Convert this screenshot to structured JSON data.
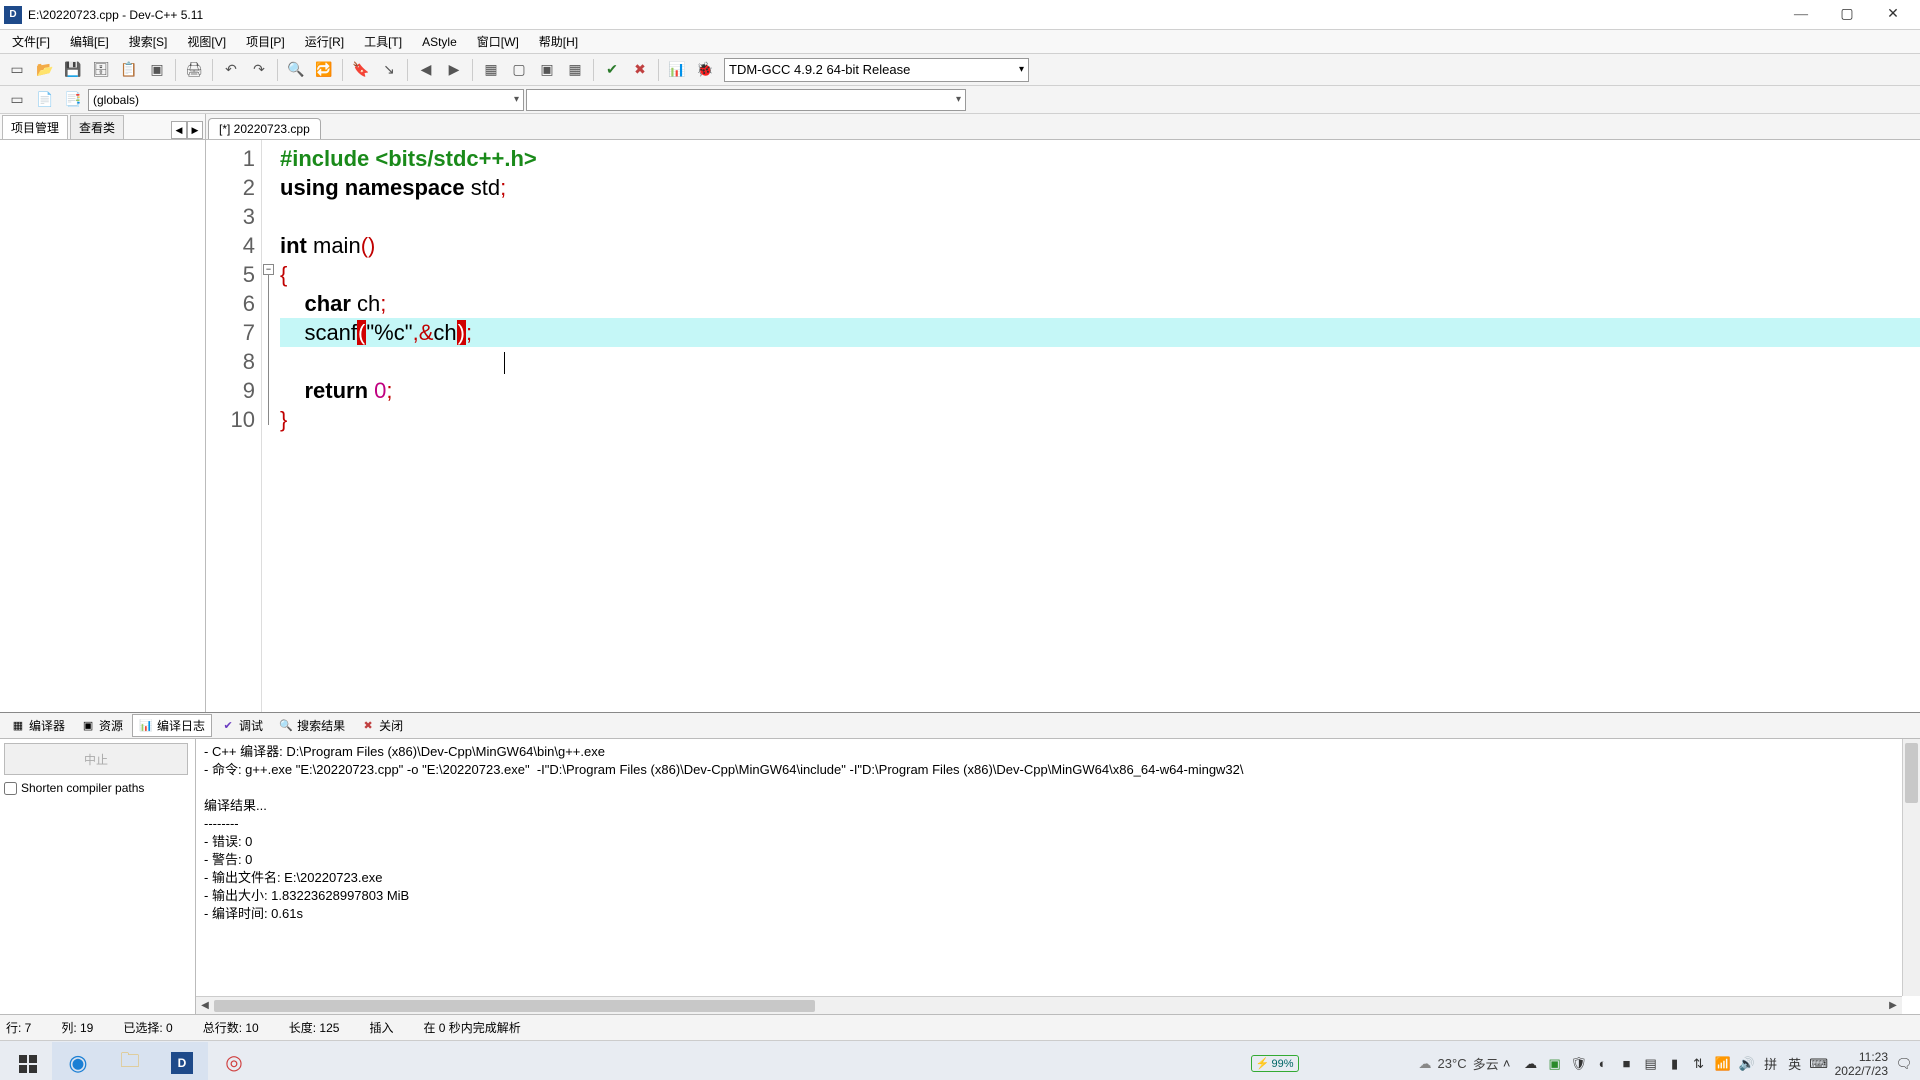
{
  "window": {
    "title": "E:\\20220723.cpp - Dev-C++ 5.11",
    "minimize": "—",
    "maximize": "▢",
    "close": "✕"
  },
  "menu": [
    "文件[F]",
    "编辑[E]",
    "搜索[S]",
    "视图[V]",
    "项目[P]",
    "运行[R]",
    "工具[T]",
    "AStyle",
    "窗口[W]",
    "帮助[H]"
  ],
  "compiler_combo": "TDM-GCC 4.9.2 64-bit Release",
  "toolbar2": {
    "scope_combo": "(globals)",
    "func_combo": ""
  },
  "sidebar": {
    "tabs": [
      "项目管理",
      "查看类"
    ],
    "nav_prev": "◀",
    "nav_next": "▶"
  },
  "doctab": "[*] 20220723.cpp",
  "code": {
    "lines": [
      "1",
      "2",
      "3",
      "4",
      "5",
      "6",
      "7",
      "8",
      "9",
      "10"
    ],
    "l1_a": "#include ",
    "l1_b": "<bits/stdc++.h>",
    "l2_a": "using ",
    "l2_b": "namespace ",
    "l2_c": "std",
    "l2_d": ";",
    "l3": "",
    "l4_a": "int ",
    "l4_b": "main",
    "l4_c": "()",
    "l5": "{",
    "l6_a": "    ",
    "l6_b": "char ",
    "l6_c": "ch",
    "l6_d": ";",
    "l7_a": "    scanf",
    "l7_b": "(",
    "l7_c": "\"%c\"",
    "l7_d": ",",
    "l7_e": "&",
    "l7_f": "ch",
    "l7_g": ")",
    "l7_h": ";",
    "l8_a": "    ",
    "l9_a": "    ",
    "l9_b": "return ",
    "l9_c": "0",
    "l9_d": ";",
    "l10": "}"
  },
  "bottom_tabs": {
    "compiler": "编译器",
    "resource": "资源",
    "log": "编译日志",
    "debug": "调试",
    "search": "搜索结果",
    "close": "关闭"
  },
  "bottom_left": {
    "stop": "中止",
    "shorten": "Shorten compiler paths"
  },
  "output": "- C++ 编译器: D:\\Program Files (x86)\\Dev-Cpp\\MinGW64\\bin\\g++.exe\n- 命令: g++.exe \"E:\\20220723.cpp\" -o \"E:\\20220723.exe\"  -I\"D:\\Program Files (x86)\\Dev-Cpp\\MinGW64\\include\" -I\"D:\\Program Files (x86)\\Dev-Cpp\\MinGW64\\x86_64-w64-mingw32\\\n\n编译结果...\n--------\n- 错误: 0\n- 警告: 0\n- 输出文件名: E:\\20220723.exe\n- 输出大小: 1.83223628997803 MiB\n- 编译时间: 0.61s",
  "status": {
    "line": "行:   7",
    "col": "列:   19",
    "sel": "已选择:   0",
    "total": "总行数:   10",
    "len": "长度:  125",
    "mode": "插入",
    "parse": "在 0 秒内完成解析"
  },
  "taskbar": {
    "battery": "99%",
    "weather_temp": "23°C",
    "weather_desc": "多云",
    "ime_lang": "英",
    "ime_pinyin": "拼",
    "time": "11:23",
    "date": "2022/7/23"
  }
}
